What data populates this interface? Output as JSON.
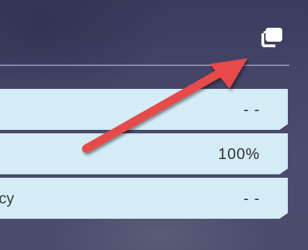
{
  "toolbar": {
    "copy_icon": "copy-icon"
  },
  "rows": [
    {
      "label": "",
      "value": "- -"
    },
    {
      "label": "",
      "value": "100%"
    },
    {
      "label": "ncy",
      "value": "- -"
    }
  ],
  "annotation": {
    "arrow_color": "#e84a4a",
    "points_to": "copy-icon"
  },
  "colors": {
    "row_background": "#d4ecf5",
    "background": "#444567",
    "divider": "#8d8eb0"
  }
}
